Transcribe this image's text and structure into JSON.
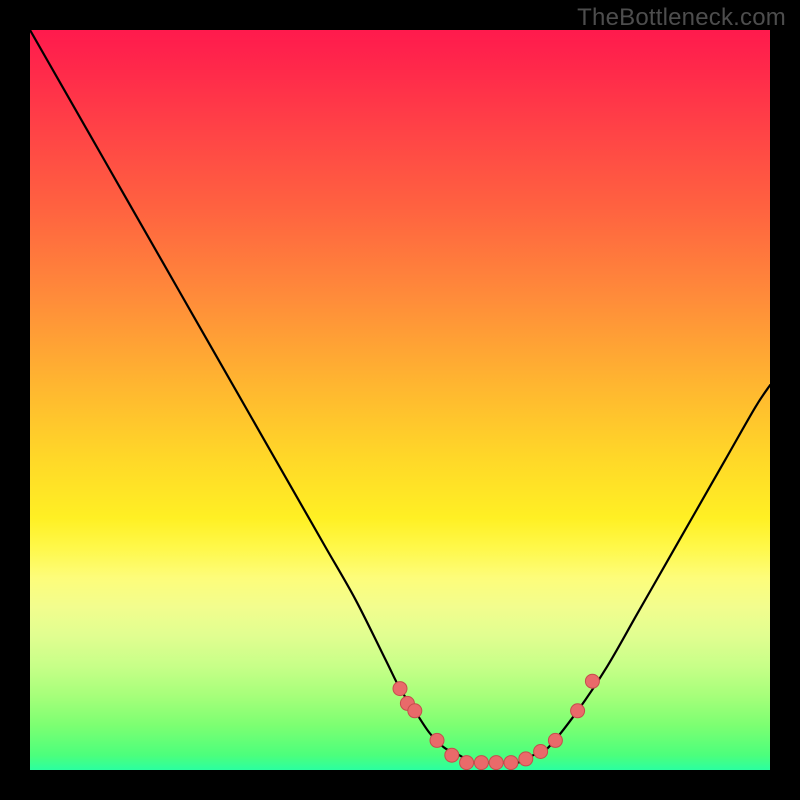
{
  "attribution": "TheBottleneck.com",
  "colors": {
    "background": "#000000",
    "attribution_text": "#4d4d4d",
    "curve_stroke": "#000000",
    "dot_fill": "#e96a6a",
    "dot_stroke": "#c64d4d"
  },
  "chart_data": {
    "type": "line",
    "title": "",
    "xlabel": "",
    "ylabel": "",
    "xlim": [
      0,
      100
    ],
    "ylim": [
      0,
      100
    ],
    "note": "Axes have no visible tick labels; x/y are expressed as 0-100 percent of plot width/height with y=0 at the bottom (good) and y=100 at the top (bad). The background gradient runs from red (top / high bottleneck) to green (bottom / no bottleneck).",
    "series": [
      {
        "name": "bottleneck-curve",
        "x": [
          0,
          4,
          8,
          12,
          16,
          20,
          24,
          28,
          32,
          36,
          40,
          44,
          48,
          50,
          52,
          54,
          56,
          58,
          60,
          62,
          64,
          66,
          68,
          70,
          74,
          78,
          82,
          86,
          90,
          94,
          98,
          100
        ],
        "y": [
          100,
          93,
          86,
          79,
          72,
          65,
          58,
          51,
          44,
          37,
          30,
          23,
          15,
          11,
          8,
          5,
          3,
          2,
          1,
          1,
          1,
          1,
          2,
          3,
          8,
          14,
          21,
          28,
          35,
          42,
          49,
          52
        ]
      }
    ],
    "highlight_dots": {
      "name": "good-fit-band",
      "points": [
        {
          "x": 50,
          "y": 11
        },
        {
          "x": 51,
          "y": 9
        },
        {
          "x": 52,
          "y": 8
        },
        {
          "x": 55,
          "y": 4
        },
        {
          "x": 57,
          "y": 2
        },
        {
          "x": 59,
          "y": 1
        },
        {
          "x": 61,
          "y": 1
        },
        {
          "x": 63,
          "y": 1
        },
        {
          "x": 65,
          "y": 1
        },
        {
          "x": 67,
          "y": 1.5
        },
        {
          "x": 69,
          "y": 2.5
        },
        {
          "x": 71,
          "y": 4
        },
        {
          "x": 74,
          "y": 8
        },
        {
          "x": 76,
          "y": 12
        }
      ]
    }
  }
}
